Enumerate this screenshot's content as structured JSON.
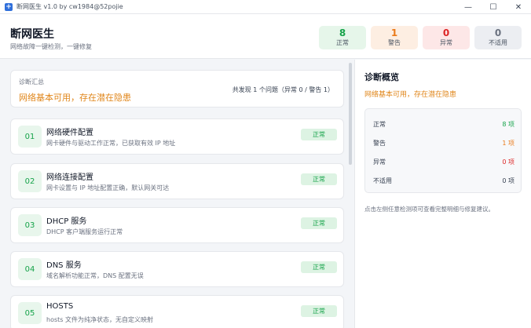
{
  "window": {
    "title": "断网医生 v1.0 by cw1984@52pojie",
    "controls": {
      "minimize": "—",
      "maximize": "☐",
      "close": "✕"
    }
  },
  "header": {
    "title": "断网医生",
    "subtitle": "网络故障一键检测，一键修复",
    "stats": [
      {
        "value": "8",
        "label": "正常",
        "kind": "ok"
      },
      {
        "value": "1",
        "label": "警告",
        "kind": "warn"
      },
      {
        "value": "0",
        "label": "异常",
        "kind": "err"
      },
      {
        "value": "0",
        "label": "不适用",
        "kind": "na"
      }
    ]
  },
  "summary": {
    "label": "诊断汇总",
    "status": "网络基本可用，存在潜在隐患",
    "count_text": "共发现 1 个问题（异常 0 / 警告 1）"
  },
  "items": [
    {
      "num": "01",
      "title": "网络硬件配置",
      "desc": "网卡硬件与驱动工作正常，已获取有效 IP 地址",
      "status": "正常"
    },
    {
      "num": "02",
      "title": "网络连接配置",
      "desc": "网卡设置与 IP 地址配置正确，默认网关可达",
      "status": "正常"
    },
    {
      "num": "03",
      "title": "DHCP 服务",
      "desc": "DHCP 客户端服务运行正常",
      "status": "正常"
    },
    {
      "num": "04",
      "title": "DNS 服务",
      "desc": "域名解析功能正常，DNS 配置无误",
      "status": "正常"
    },
    {
      "num": "05",
      "title": "HOSTS",
      "desc": "hosts 文件为纯净状态，无自定义映射",
      "status": "正常"
    }
  ],
  "overview": {
    "title": "诊断概览",
    "status": "网络基本可用，存在潜在隐患",
    "rows": [
      {
        "key": "正常",
        "value": "8 项",
        "kind": "ok"
      },
      {
        "key": "警告",
        "value": "1 项",
        "kind": "warn"
      },
      {
        "key": "异常",
        "value": "0 项",
        "kind": "err"
      },
      {
        "key": "不适用",
        "value": "0 项",
        "kind": "na"
      }
    ],
    "hint": "点击左侧任意检测项可查看完整明细与修复建议。"
  }
}
